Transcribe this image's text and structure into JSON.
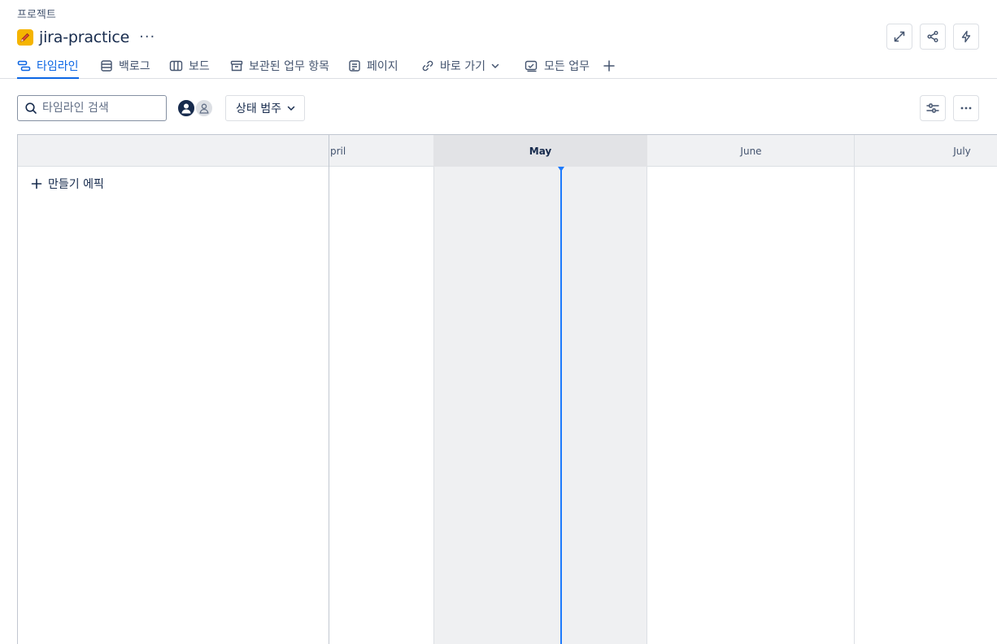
{
  "breadcrumb": "프로젝트",
  "project": {
    "title": "jira-practice",
    "more": "···"
  },
  "tabs": [
    {
      "label": "타임라인",
      "icon": "timeline-icon",
      "active": true
    },
    {
      "label": "백로그",
      "icon": "backlog-icon"
    },
    {
      "label": "보드",
      "icon": "board-icon"
    },
    {
      "label": "보관된 업무 항목",
      "icon": "archive-icon"
    },
    {
      "label": "페이지",
      "icon": "page-icon"
    },
    {
      "label": "바로 가기",
      "icon": "link-icon",
      "dropdown": true
    },
    {
      "label": "모든 업무",
      "icon": "all-work-icon"
    }
  ],
  "toolbar": {
    "search_placeholder": "타임라인 검색",
    "status_filter": "상태 범주"
  },
  "timeline": {
    "months": [
      "pril",
      "May",
      "June",
      "July"
    ],
    "current_month": "May",
    "create_epic": "만들기 에픽"
  },
  "colors": {
    "accent": "#0c66e4",
    "today_line": "#1d7afc",
    "project_icon": "#f5b400"
  }
}
